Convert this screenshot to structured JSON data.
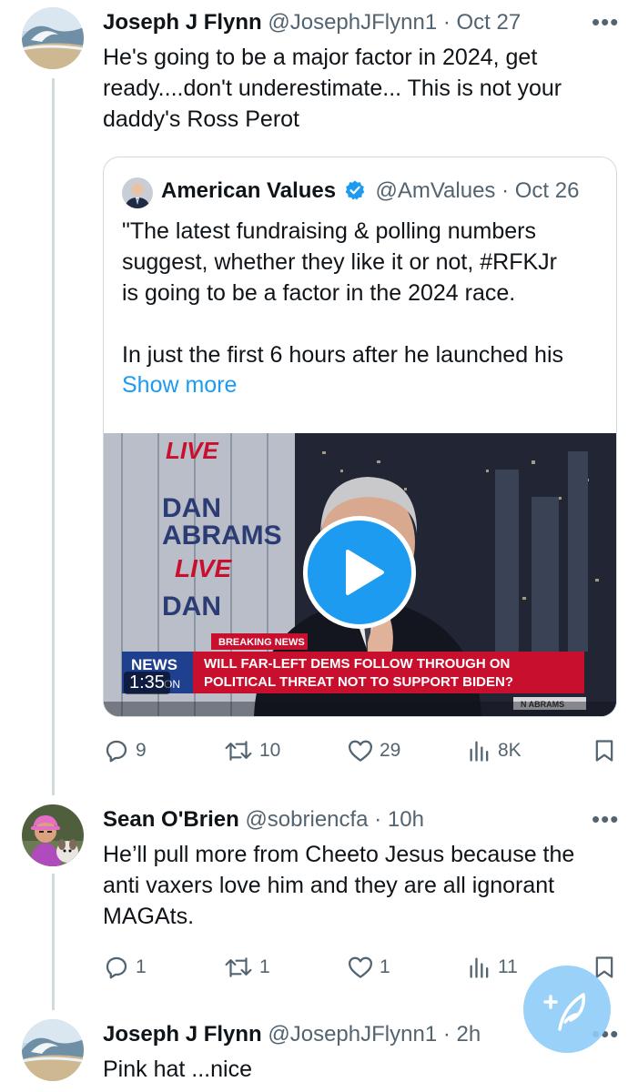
{
  "tweets": [
    {
      "author": "Joseph J Flynn",
      "handle": "@JosephJFlynn1",
      "separator": "·",
      "time": "Oct 27",
      "text": "He's going to be a major factor in 2024, get\nready....don't underestimate... This is not your\ndaddy's Ross Perot",
      "stats": {
        "replies": "9",
        "retweets": "10",
        "likes": "29",
        "views": "8K"
      }
    },
    {
      "author": "Sean O'Brien",
      "handle": "@sobriencfa",
      "separator": "·",
      "time": "10h",
      "text": "He’ll pull more from Cheeto Jesus because the\nanti vaxers love him and they are all ignorant\nMAGAts.",
      "stats": {
        "replies": "1",
        "retweets": "1",
        "likes": "1",
        "views": "11"
      }
    },
    {
      "author": "Joseph J Flynn",
      "handle": "@JosephJFlynn1",
      "separator": "·",
      "time": "2h",
      "text": "Pink hat ...nice"
    }
  ],
  "quote": {
    "author": "American Values",
    "handle": "@AmValueѕ",
    "separator": "·",
    "time": "Oct 26",
    "text": "\"The latest fundraising & polling numbers\nsuggest, whether they like it or not, #RFKJr\nis going to be a factor in the 2024 race.\n\nIn just the first 6 hours after he launched his",
    "show_more": "Show more",
    "video": {
      "duration": "1:35",
      "studio_text_1": "DAN\nABRAMS",
      "studio_live": "LIVE",
      "breaking_label": "BREAKING NEWS",
      "headline_line1": "WILL FAR-LEFT DEMS FOLLOW THROUGH ON",
      "headline_line2": "POLITICAL THREAT NOT TO SUPPORT BIDEN?",
      "network_logo": "NEWS",
      "network_sub": "ON",
      "show_tag": "N ABRAMS"
    }
  },
  "colors": {
    "accent": "#1d9bf0",
    "muted": "#536471",
    "border": "#cfd9de",
    "verified": "#1d9bf0",
    "breaking_red": "#c8102e"
  },
  "icons": [
    "more-icon",
    "reply-icon",
    "retweet-icon",
    "like-icon",
    "views-icon",
    "bookmark-icon",
    "verified-icon",
    "play-icon",
    "compose-icon"
  ]
}
